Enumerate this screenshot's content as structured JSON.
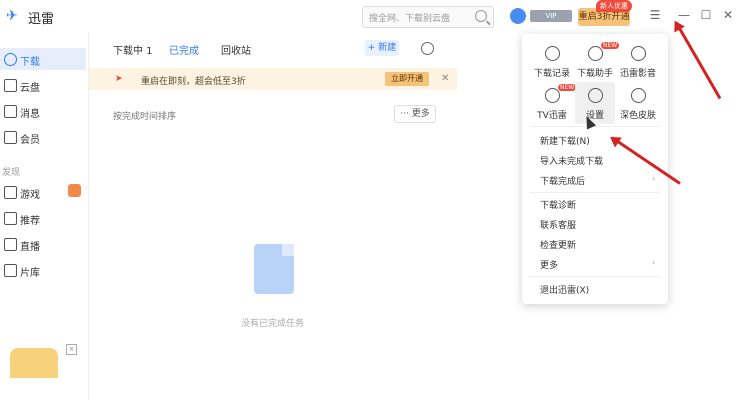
{
  "app": {
    "title": "迅雷",
    "logo_icon": "thunder-logo-icon"
  },
  "titlebar": {
    "search_placeholder": "搜全网、下载别云盘",
    "vip_badge": "VIP",
    "open_vip_label": "重启3折开通",
    "new_user_tag": "新人优惠"
  },
  "sidebar": {
    "items": [
      {
        "label": "下载",
        "icon": "download-icon"
      },
      {
        "label": "云盘",
        "icon": "cloud-icon"
      },
      {
        "label": "消息",
        "icon": "message-icon"
      },
      {
        "label": "会员",
        "icon": "member-icon"
      }
    ],
    "section_label": "发现",
    "discover_items": [
      {
        "label": "游戏",
        "icon": "game-icon"
      },
      {
        "label": "推荐",
        "icon": "recommend-icon"
      },
      {
        "label": "直播",
        "icon": "live-icon"
      },
      {
        "label": "片库",
        "icon": "library-icon"
      }
    ]
  },
  "main": {
    "tabs": [
      "下载中 1",
      "已完成",
      "回收站"
    ],
    "new_button": "+ 新建",
    "banner": {
      "text": "重启在即刻，超会低至3折",
      "button": "立即开通"
    },
    "subrow_text": "按完成时间排序",
    "more_button": "··· 更多",
    "empty_text": "没有已完成任务"
  },
  "menu": {
    "grid": [
      {
        "label": "下载记录",
        "icon": "history-icon"
      },
      {
        "label": "下载助手",
        "icon": "assistant-icon",
        "badge": "NEW"
      },
      {
        "label": "迅雷影音",
        "icon": "player-icon"
      },
      {
        "label": "TV迅雷",
        "icon": "tv-icon",
        "badge": "NEW"
      },
      {
        "label": "设置",
        "icon": "gear-icon"
      },
      {
        "label": "深色皮肤",
        "icon": "moon-icon"
      }
    ],
    "items": [
      {
        "label": "新建下载(N)"
      },
      {
        "label": "导入未完成下载"
      },
      {
        "label": "下载完成后",
        "submenu": true
      },
      {
        "label": "下载诊断"
      },
      {
        "label": "联系客服"
      },
      {
        "label": "检查更新"
      },
      {
        "label": "更多",
        "submenu": true
      },
      {
        "label": "退出迅雷(X)"
      }
    ]
  },
  "colors": {
    "accent": "#2f7cf6",
    "annotation": "#d32222",
    "vip": "#f5c27a"
  }
}
